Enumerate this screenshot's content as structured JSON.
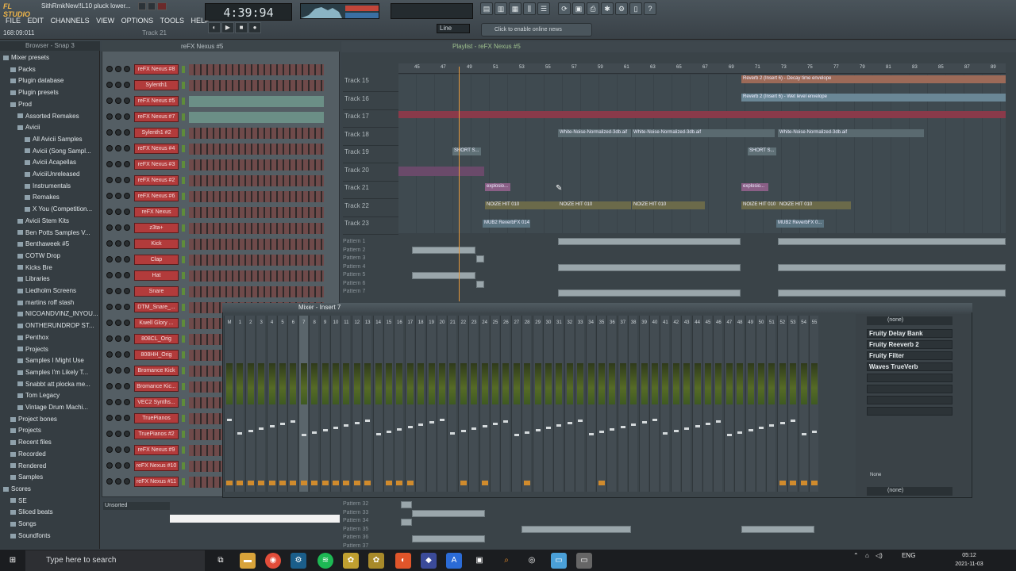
{
  "app": {
    "logo": "FL STUDIO",
    "song_title": "SithRmkNew!!L10 pluck lower...",
    "menu": [
      "FILE",
      "EDIT",
      "CHANNELS",
      "VIEW",
      "OPTIONS",
      "TOOLS",
      "HELP"
    ],
    "hint_left": "168:09:011",
    "hint_right": "Track 21",
    "time": "4:39:94",
    "snap": "Line",
    "news": "Click to enable online news"
  },
  "browser": {
    "title": "Browser - Snap 3",
    "items": [
      {
        "label": "Mixer presets",
        "indent": 0
      },
      {
        "label": "Packs",
        "indent": 1
      },
      {
        "label": "Plugin database",
        "indent": 1
      },
      {
        "label": "Plugin presets",
        "indent": 1
      },
      {
        "label": "Prod",
        "indent": 1
      },
      {
        "label": "Assorted Remakes",
        "indent": 2
      },
      {
        "label": "Avicii",
        "indent": 2
      },
      {
        "label": "All Avicii Samples",
        "indent": 3
      },
      {
        "label": "Avicii (Song Sampl...",
        "indent": 3
      },
      {
        "label": "Avicii Acapellas",
        "indent": 3
      },
      {
        "label": "AviciiUnreleased",
        "indent": 3
      },
      {
        "label": "Instrumentals",
        "indent": 3
      },
      {
        "label": "Remakes",
        "indent": 3
      },
      {
        "label": "X You (Competition...",
        "indent": 3
      },
      {
        "label": "Avicii Stem Kits",
        "indent": 2
      },
      {
        "label": "Ben Potts Samples V...",
        "indent": 2
      },
      {
        "label": "Benthaweek #5",
        "indent": 2
      },
      {
        "label": "COTW Drop",
        "indent": 2
      },
      {
        "label": "Kicks Bre",
        "indent": 2
      },
      {
        "label": "Libraries",
        "indent": 2
      },
      {
        "label": "Liedholm Screens",
        "indent": 2
      },
      {
        "label": "martins roff stash",
        "indent": 2
      },
      {
        "label": "NICOANDVINZ_INYOU...",
        "indent": 2
      },
      {
        "label": "ONTHERUNDROP ST...",
        "indent": 2
      },
      {
        "label": "Penthox",
        "indent": 2
      },
      {
        "label": "Projects",
        "indent": 2
      },
      {
        "label": "Samples I Might Use",
        "indent": 2
      },
      {
        "label": "Samples I'm Likely T...",
        "indent": 2
      },
      {
        "label": "Snabbt att plocka me...",
        "indent": 2
      },
      {
        "label": "Tom Legacy",
        "indent": 2
      },
      {
        "label": "Vintage Drum Machi...",
        "indent": 2
      },
      {
        "label": "Project bones",
        "indent": 1
      },
      {
        "label": "Projects",
        "indent": 1
      },
      {
        "label": "Recent files",
        "indent": 1
      },
      {
        "label": "Recorded",
        "indent": 1
      },
      {
        "label": "Rendered",
        "indent": 1
      },
      {
        "label": "Samples",
        "indent": 1
      },
      {
        "label": "Scores",
        "indent": 0
      },
      {
        "label": "SE",
        "indent": 1
      },
      {
        "label": "Sliced beats",
        "indent": 1
      },
      {
        "label": "Songs",
        "indent": 1
      },
      {
        "label": "Soundfonts",
        "indent": 1
      }
    ]
  },
  "channel_rack": {
    "title": "reFX Nexus #5",
    "sort": "Unsorted",
    "channels": [
      "reFX Nexus #8",
      "Sylenth1",
      "reFX Nexus #5",
      "reFX Nexus #7",
      "Sylenth1 #2",
      "reFX Nexus #4",
      "reFX Nexus #3",
      "reFX Nexus #2",
      "reFX Nexus #6",
      "reFX Nexus",
      "z3ta+",
      "Kick",
      "Clap",
      "Hat",
      "Snare",
      "DTM_Snare_...",
      "Kwell Glory ...",
      "808CL_Orig",
      "808HH_Orig",
      "Bromance Kick",
      "Bromance Kic...",
      "VEC2 Synths...",
      "TruePianos",
      "TruePianos #2",
      "reFX Nexus #9",
      "reFX Nexus #10",
      "reFX Nexus #11"
    ]
  },
  "playlist": {
    "title": "Playlist - reFX Nexus #5",
    "timeline": [
      "45",
      "47",
      "49",
      "51",
      "53",
      "55",
      "57",
      "59",
      "61",
      "63",
      "65",
      "67",
      "69",
      "71",
      "73",
      "75",
      "77",
      "79",
      "81",
      "83",
      "85",
      "87",
      "89"
    ],
    "tracks": [
      "Track 15",
      "Track 16",
      "Track 17",
      "Track 18",
      "Track 19",
      "Track 20",
      "Track 21",
      "Track 22",
      "Track 23"
    ],
    "clips": [
      {
        "label": "Reverb 2 (Insert 6) - Decay time envelope",
        "color": "#9c6a58"
      },
      {
        "label": "Reverb 2 (Insert 6) - Wet level envelope",
        "color": "#6a8796"
      },
      {
        "label": "White-Noise-Normalized-3db.aif",
        "color": "#5a6a70"
      },
      {
        "label": "White-Noise-Normalized-3db.aif",
        "color": "#5a6a70"
      },
      {
        "label": "White-Noise-Normalized-3db.aif",
        "color": "#5a6a70"
      },
      {
        "label": "SHORT S...",
        "color": "#5f7076"
      },
      {
        "label": "SHORT S...",
        "color": "#5f7076"
      },
      {
        "label": "explosio...",
        "color": "#8a5f86"
      },
      {
        "label": "explosio...",
        "color": "#8a5f86"
      },
      {
        "label": "NOIZE HIT 010",
        "color": "#6b6a4a"
      },
      {
        "label": "NOIZE HIT 010",
        "color": "#6b6a4a"
      },
      {
        "label": "NOIZE HIT 010",
        "color": "#6b6a4a"
      },
      {
        "label": "NOIZE HIT 010",
        "color": "#6b6a4a"
      },
      {
        "label": "NOIZE HIT 010",
        "color": "#6b6a4a"
      },
      {
        "label": "MUB2 ReverbFX 014",
        "color": "#5a7380"
      },
      {
        "label": "MUB2 ReverbFX 0...",
        "color": "#5a7380"
      }
    ],
    "patterns_top": [
      "Pattern 1",
      "Pattern 2",
      "Pattern 3",
      "Pattern 4",
      "Pattern 5",
      "Pattern 6",
      "Pattern 7"
    ],
    "patterns_bottom": [
      "Pattern 32",
      "Pattern 33",
      "Pattern 34",
      "Pattern 35",
      "Pattern 36",
      "Pattern 37"
    ]
  },
  "mixer": {
    "title": "Mixer - Insert 7",
    "strip_count": 56,
    "fx_in": "(none)",
    "fx_out": "(none)",
    "fx_slots": [
      "Fruity Delay Bank",
      "Fruity Reeverb 2",
      "Fruity Filter",
      "Waves TrueVerb",
      "",
      "",
      "",
      ""
    ],
    "eq_none": "None"
  },
  "taskbar": {
    "search_placeholder": "Type here to search",
    "lang": "ENG",
    "time": "05:12",
    "date": "2021-11-03"
  }
}
